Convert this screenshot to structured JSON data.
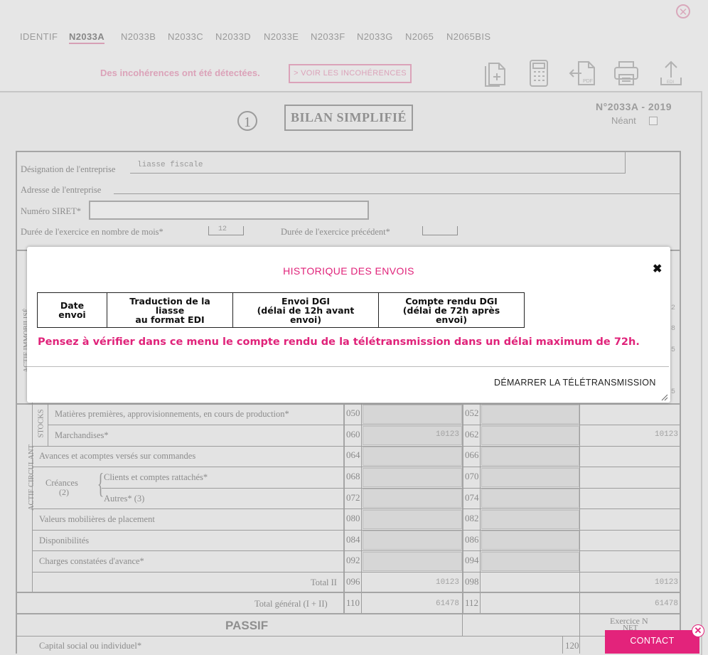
{
  "tabs": [
    "IDENTIF",
    "N2033A",
    "N2033B",
    "N2033C",
    "N2033D",
    "N2033E",
    "N2033F",
    "N2033G",
    "N2065",
    "N2065BIS"
  ],
  "active_tab": "N2033A",
  "incoherence": {
    "message": "Des incohérences ont été détectées.",
    "button": "> VOIR LES INCOHÉRENCES"
  },
  "toolbar": {
    "icons": [
      "copy-add-icon",
      "calculator-icon",
      "pdf-icon",
      "print-icon",
      "edi-upload-icon"
    ],
    "pdf_label": "PDF",
    "edi_label": "EDI"
  },
  "form": {
    "section_number": "1",
    "title": "BILAN SIMPLIFIÉ",
    "code": "N°2033A - 2019",
    "neant_label": "Néant",
    "designation_label": "Désignation de l'entreprise",
    "designation_value": "liasse fiscale",
    "adresse_label": "Adresse de l'entreprise",
    "siret_label": "Numéro SIRET*",
    "duree_label": "Durée de l'exercice en nombre de mois*",
    "duree_value": "12",
    "duree_prec_label": "Durée de l'exercice précédent*",
    "actif_immobilise": "ACTIF IMMOBILISÉ",
    "actif_circulant": "ACTIF CIRCULANT",
    "stocks": "STOCKS",
    "rows": [
      {
        "label": "Matières premières, approvisionnements, en cours de production*",
        "code1": "050",
        "val1": "",
        "code2": "052",
        "val2": ""
      },
      {
        "label": "Marchandises*",
        "code1": "060",
        "val1": "10123",
        "code2": "062",
        "val2": "10123"
      },
      {
        "label": "Avances et acomptes versés sur commandes",
        "code1": "064",
        "val1": "",
        "code2": "066",
        "val2": ""
      },
      {
        "label": "Clients et comptes rattachés*",
        "code1": "068",
        "val1": "",
        "code2": "070",
        "val2": ""
      },
      {
        "label": "Autres* (3)",
        "code1": "072",
        "val1": "",
        "code2": "074",
        "val2": ""
      },
      {
        "label": "Valeurs mobilières de placement",
        "code1": "080",
        "val1": "",
        "code2": "082",
        "val2": ""
      },
      {
        "label": "Disponibilités",
        "code1": "084",
        "val1": "",
        "code2": "086",
        "val2": ""
      },
      {
        "label": "Charges constatées d'avance*",
        "code1": "092",
        "val1": "",
        "code2": "094",
        "val2": ""
      },
      {
        "label": "Total II",
        "code1": "096",
        "val1": "10123",
        "code2": "098",
        "val2": "10123"
      }
    ],
    "creances_label": "Créances",
    "creances_note": "(2)",
    "total_general": {
      "label": "Total général (I + II)",
      "code1": "110",
      "val1": "61478",
      "code2": "112",
      "val2": "61478"
    },
    "right_values": [
      "2",
      "8",
      "5",
      "5"
    ],
    "passif": "PASSIF",
    "exercice_label": "Exercice N",
    "net_label": "NET",
    "capital_label": "Capital social ou individuel*",
    "capital_code": "120"
  },
  "modal": {
    "title": "HISTORIQUE DES ENVOIS",
    "columns": [
      [
        "Date envoi"
      ],
      [
        "Traduction de la liasse",
        "au format EDI"
      ],
      [
        "Envoi DGI",
        "(délai de 12h avant envoi)"
      ],
      [
        "Compte rendu DGI",
        "(délai de 72h après envoi)"
      ]
    ],
    "warning": "Pensez à vérifier dans ce menu le compte rendu de la télétransmission dans un délai maximum de 72h.",
    "action": "DÉMARRER LA TÉLÉTRANSMISSION"
  },
  "contact": {
    "label": "CONTACT"
  },
  "colors": {
    "accent": "#e0237a",
    "overlay": "#e6e6e6"
  }
}
